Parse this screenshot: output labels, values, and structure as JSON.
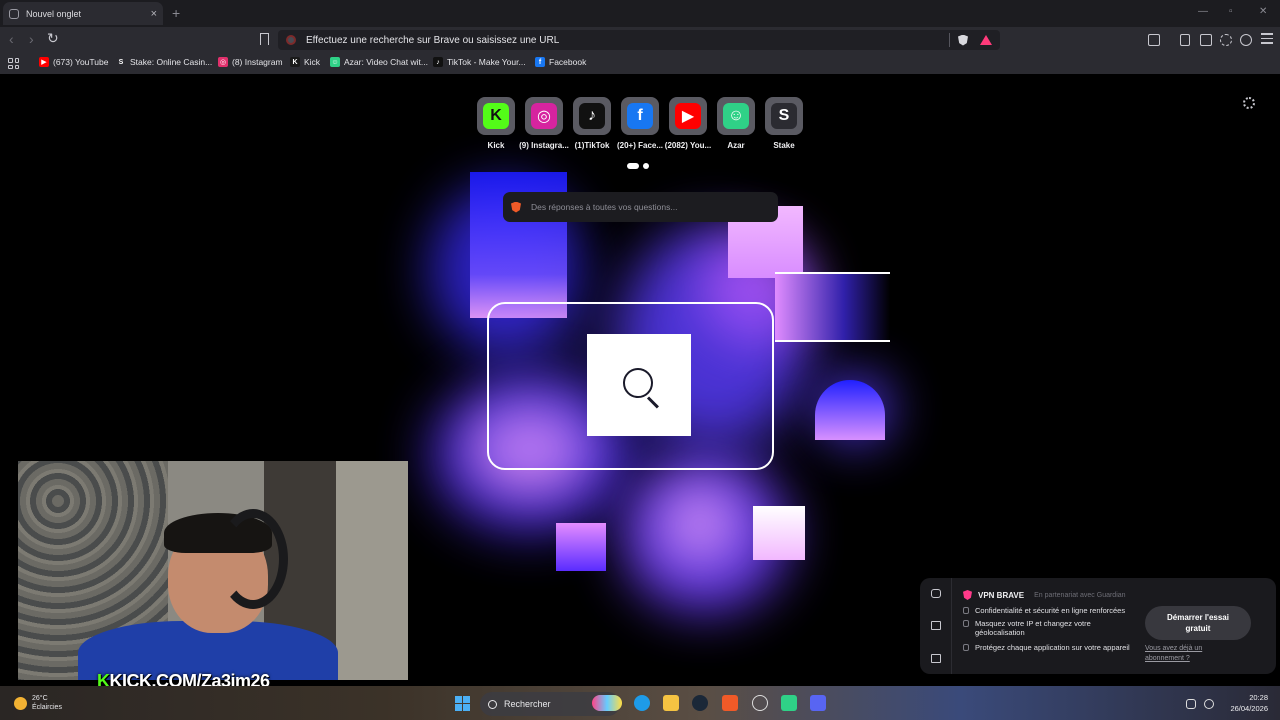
{
  "browser": {
    "tab": {
      "title": "Nouvel onglet",
      "close": "×"
    },
    "new_tab_symbol": "+",
    "window_controls": {
      "minimize": "—",
      "maximize": "▫",
      "close": "✕"
    },
    "nav": {
      "back": "‹",
      "forward": "›",
      "reload": "↻"
    },
    "address_bar": {
      "text": "Effectuez une recherche sur Brave ou saisissez une URL"
    },
    "bookmarks": [
      {
        "label": "(673) YouTube",
        "icon": "youtube-icon",
        "color": "#ff0000",
        "glyph": "▶"
      },
      {
        "label": "Stake: Online Casin...",
        "icon": "stake-icon",
        "color": "#2b2b31",
        "glyph": "S"
      },
      {
        "label": "(8) Instagram",
        "icon": "instagram-icon",
        "color": "#e1306c",
        "glyph": "◎"
      },
      {
        "label": "Kick",
        "icon": "kick-icon",
        "color": "#1a1a1a",
        "glyph": "K"
      },
      {
        "label": "Azar: Video Chat wit...",
        "icon": "azar-icon",
        "color": "#2fd187",
        "glyph": "☺"
      },
      {
        "label": "TikTok - Make Your...",
        "icon": "tiktok-icon",
        "color": "#111111",
        "glyph": "♪"
      },
      {
        "label": "Facebook",
        "icon": "facebook-icon",
        "color": "#1877f2",
        "glyph": "f"
      }
    ]
  },
  "new_tab_page": {
    "top_sites": [
      {
        "label": "Kick",
        "icon": "kick-icon",
        "color": "#53fc18",
        "glyph": "K",
        "glyph_color": "#111"
      },
      {
        "label": "(9) Instagra...",
        "icon": "instagram-icon",
        "color": "#d6249f",
        "glyph": "◎",
        "glyph_color": "#fff"
      },
      {
        "label": "(1)TikTok",
        "icon": "tiktok-icon",
        "color": "#111111",
        "glyph": "♪",
        "glyph_color": "#fff"
      },
      {
        "label": "(20+) Face...",
        "icon": "facebook-icon",
        "color": "#1877f2",
        "glyph": "f",
        "glyph_color": "#fff"
      },
      {
        "label": "(2082) You...",
        "icon": "youtube-icon",
        "color": "#ff0000",
        "glyph": "▶",
        "glyph_color": "#fff"
      },
      {
        "label": "Azar",
        "icon": "azar-icon",
        "color": "#2fd187",
        "glyph": "☺",
        "glyph_color": "#fff"
      },
      {
        "label": "Stake",
        "icon": "stake-icon",
        "color": "#2b2b31",
        "glyph": "S",
        "glyph_color": "#fff"
      }
    ],
    "leo_placeholder": "Des réponses à toutes vos questions..."
  },
  "stream_overlay": {
    "kick_prefix": "K",
    "kick_url": "KICK.COM/Za3im26"
  },
  "vpn_popup": {
    "title": "VPN BRAVE",
    "partner": "En partenariat avec",
    "partner_brand": "Guardian",
    "features": [
      "Confidentialité et sécurité en ligne renforcées",
      "Masquez votre IP et changez votre géolocalisation",
      "Protégez chaque application sur votre appareil"
    ],
    "cta": "Démarrer l'essai gratuit",
    "already": "Vous avez déjà un abonnement ?"
  },
  "taskbar": {
    "weather": {
      "temp": "26°C",
      "condition": "Éclaircies"
    },
    "search_label": "Rechercher",
    "time": "20:28",
    "date": "26/04/2026"
  }
}
